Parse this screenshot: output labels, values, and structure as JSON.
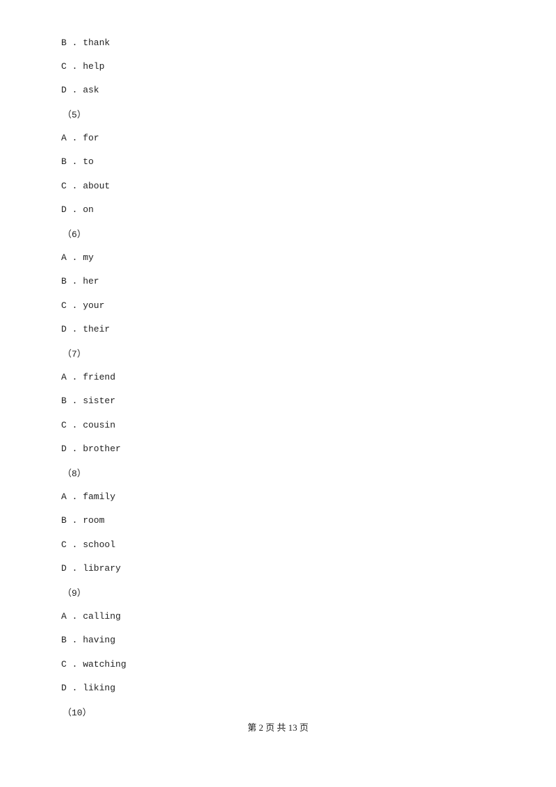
{
  "lines": [
    {
      "type": "option",
      "text": "B . thank"
    },
    {
      "type": "option",
      "text": "C . help"
    },
    {
      "type": "option",
      "text": "D . ask"
    },
    {
      "type": "number",
      "text": "（5）"
    },
    {
      "type": "option",
      "text": "A . for"
    },
    {
      "type": "option",
      "text": "B . to"
    },
    {
      "type": "option",
      "text": "C . about"
    },
    {
      "type": "option",
      "text": "D . on"
    },
    {
      "type": "number",
      "text": "（6）"
    },
    {
      "type": "option",
      "text": "A . my"
    },
    {
      "type": "option",
      "text": "B . her"
    },
    {
      "type": "option",
      "text": "C . your"
    },
    {
      "type": "option",
      "text": "D . their"
    },
    {
      "type": "number",
      "text": "（7）"
    },
    {
      "type": "option",
      "text": "A . friend"
    },
    {
      "type": "option",
      "text": "B . sister"
    },
    {
      "type": "option",
      "text": "C . cousin"
    },
    {
      "type": "option",
      "text": "D . brother"
    },
    {
      "type": "number",
      "text": "（8）"
    },
    {
      "type": "option",
      "text": "A . family"
    },
    {
      "type": "option",
      "text": "B . room"
    },
    {
      "type": "option",
      "text": "C . school"
    },
    {
      "type": "option",
      "text": "D . library"
    },
    {
      "type": "number",
      "text": "（9）"
    },
    {
      "type": "option",
      "text": "A . calling"
    },
    {
      "type": "option",
      "text": "B . having"
    },
    {
      "type": "option",
      "text": "C . watching"
    },
    {
      "type": "option",
      "text": "D . liking"
    },
    {
      "type": "number",
      "text": "（10）"
    }
  ],
  "footer": "第 2 页 共 13 页"
}
